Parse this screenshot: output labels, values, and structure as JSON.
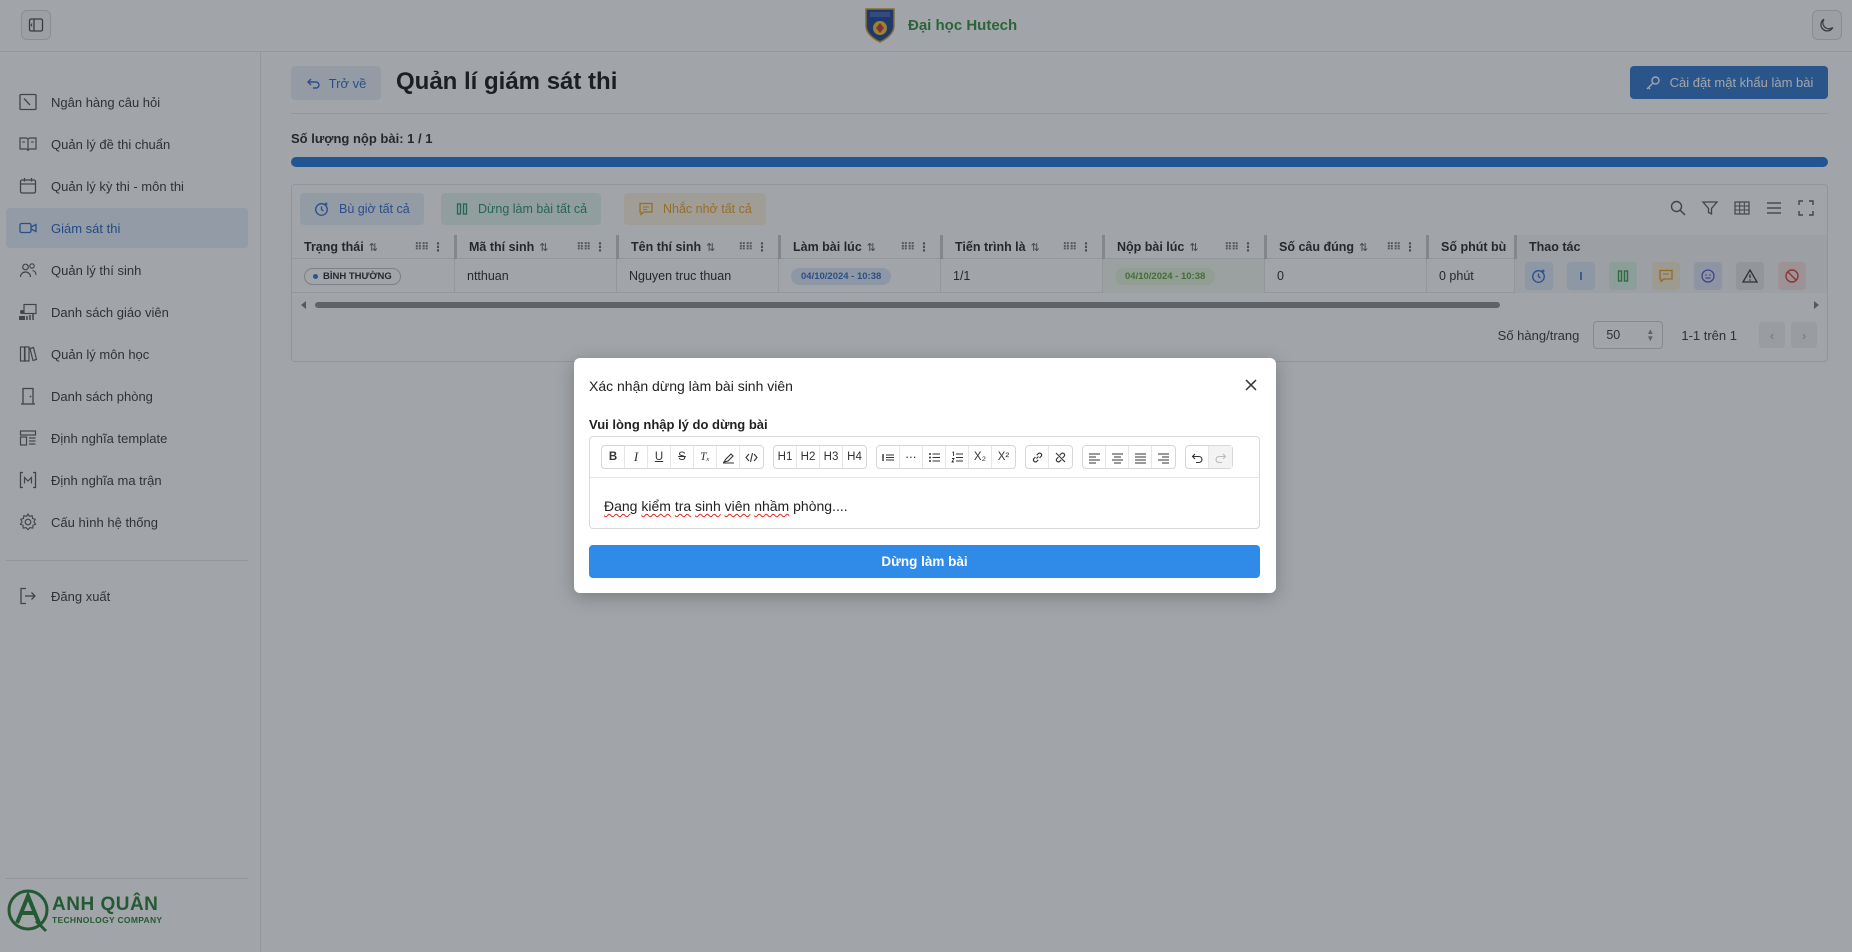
{
  "brand": {
    "name": "Đại học Hutech"
  },
  "sidebar": {
    "items": [
      {
        "label": "Ngân hàng câu hỏi",
        "icon": "question-bank-icon"
      },
      {
        "label": "Quản lý đề thi chuẩn",
        "icon": "book-open-icon"
      },
      {
        "label": "Quản lý kỳ thi - môn thi",
        "icon": "calendar-icon"
      },
      {
        "label": "Giám sát thi",
        "icon": "video-camera-icon",
        "active": true
      },
      {
        "label": "Quản lý thí sinh",
        "icon": "users-icon"
      },
      {
        "label": "Danh sách giáo viên",
        "icon": "teacher-board-icon"
      },
      {
        "label": "Quản lý môn học",
        "icon": "books-icon"
      },
      {
        "label": "Danh sách phòng",
        "icon": "door-icon"
      },
      {
        "label": "Định nghĩa template",
        "icon": "template-icon"
      },
      {
        "label": "Định nghĩa ma trận",
        "icon": "matrix-brackets-icon"
      },
      {
        "label": "Cấu hình hệ thống",
        "icon": "gear-icon"
      }
    ],
    "logout": "Đăng xuất",
    "logo": {
      "name": "ANH QUÂN",
      "sub": "TECHNOLOGY COMPANY"
    }
  },
  "main": {
    "back_label": "Trở về",
    "title": "Quản lí giám sát thi",
    "password_button": "Cài đặt mật khẩu làm bài",
    "submission_count": "Số lượng nộp bài: 1 / 1",
    "submission_progress": 1.0,
    "toolbar": {
      "extend_all": "Bù giờ tất cả",
      "stop_all": "Dừng làm bài tất cả",
      "remind_all": "Nhắc nhở tất cả"
    },
    "columns": [
      "Trạng thái",
      "Mã thí sinh",
      "Tên thí sinh",
      "Làm bài lúc",
      "Tiến trình là",
      "Nộp bài lúc",
      "Số câu đúng",
      "Số phút bù",
      "Thao tác"
    ],
    "row": {
      "status": "BÌNH THƯỜNG",
      "student_id": "ntthuan",
      "student_name": "Nguyen truc thuan",
      "start_time": "04/10/2024 - 10:38",
      "progress": "1/1",
      "submit_time": "04/10/2024 - 10:38",
      "correct": "0",
      "extra_minutes": "0 phút"
    },
    "pagination": {
      "rows_per_page_label": "Số hàng/trang",
      "rows_per_page": "50",
      "range": "1-1 trên 1"
    }
  },
  "modal": {
    "title": "Xác nhận dừng làm bài sinh viên",
    "field_label": "Vui lòng nhập lý do dừng bài",
    "content_words": [
      "Đang",
      "kiểm",
      "tra",
      "sinh",
      "viên",
      "nhầm",
      "phòng...."
    ],
    "toolbar": {
      "headings": [
        "H1",
        "H2",
        "H3",
        "H4"
      ],
      "sub": "X₂",
      "sup": "X²",
      "clear_format": "Tₓ"
    },
    "submit": "Dừng làm bài"
  },
  "colors": {
    "primary": "#2b71c9",
    "brand_green": "#2e8b3a",
    "active_nav_bg": "#e6eef9",
    "stop_button": "#2f8ae8"
  }
}
